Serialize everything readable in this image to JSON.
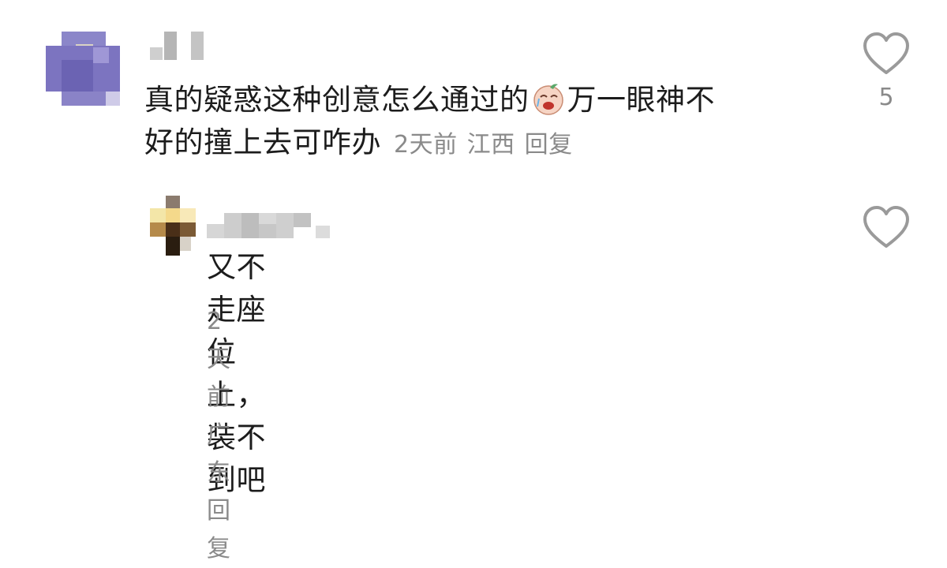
{
  "comments": [
    {
      "text": "真的疑惑这种创意怎么通过的",
      "text_after_emoji": "万一眼神不",
      "text_line2": "好的撞上去可咋办",
      "emoji": "crying-face-emoji",
      "time": "2天前",
      "location": "江西",
      "reply_label": "回复",
      "likes": "5"
    },
    {
      "text": "又不走座位上，装不到吧",
      "time": "2天前",
      "location": "广东",
      "reply_label": "回复",
      "likes": ""
    }
  ],
  "icons": {
    "like": "heart-outline-icon"
  },
  "colors": {
    "meta": "#8a8a8a",
    "text": "#1c1c1c",
    "icon": "#9a9a9a"
  }
}
